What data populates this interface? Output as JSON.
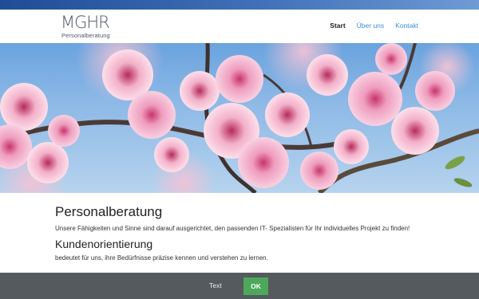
{
  "brand": {
    "logo_mark": "MGHR",
    "logo_sub": "Personalberatung"
  },
  "nav": {
    "items": [
      {
        "label": "Start",
        "active": true
      },
      {
        "label": "Über uns",
        "active": false
      },
      {
        "label": "Kontakt",
        "active": false
      }
    ]
  },
  "hero": {
    "icon": "blossom-photo"
  },
  "content": {
    "heading1": "Personalberatung",
    "paragraph1": "Unsere Fähigkeiten und Sinne sind darauf ausgerichtet, den passenden IT- Spezialisten für Ihr individuelles Projekt zu finden!",
    "heading2": "Kundenorientierung",
    "paragraph2": "bedeutet für uns, ihre Bedürfnisse präzise kennen und verstehen zu lernen."
  },
  "cookie": {
    "text": "Text",
    "ok_label": "OK"
  },
  "colors": {
    "topbar": "#2a5aa3",
    "nav_link": "#3a8fd6",
    "cookie_bg": "#555a5e",
    "ok_button": "#4ea85a"
  }
}
